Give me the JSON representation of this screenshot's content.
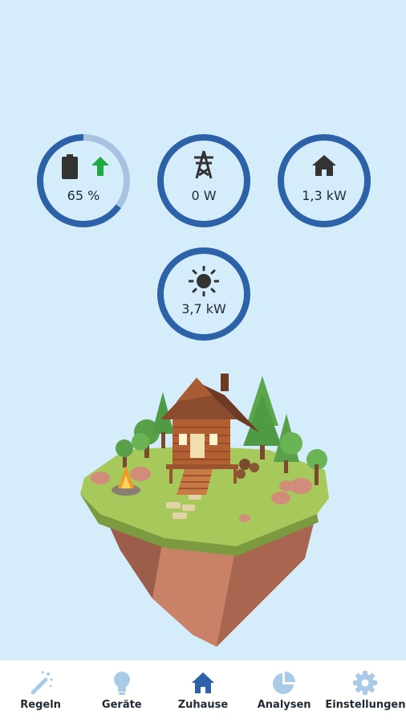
{
  "gauges": {
    "battery": {
      "value": "65 %",
      "level": 0.65,
      "icons": [
        "battery-icon",
        "arrow-up-icon"
      ]
    },
    "grid": {
      "value": "0 W",
      "level": 1.0,
      "icon": "power-pylon-icon"
    },
    "home": {
      "value": "1,3 kW",
      "level": 1.0,
      "icon": "house-icon"
    },
    "solar": {
      "value": "3,7 kW",
      "level": 1.0,
      "icon": "sun-icon"
    }
  },
  "colors": {
    "background": "#d5edfb",
    "ring": "#2d62a8",
    "ring_track": "#a8c3e2",
    "charging_arrow": "#1eaa3c",
    "nav_active": "#2d62a8",
    "nav_inactive": "#aacbe8"
  },
  "nav": {
    "items": [
      {
        "label": "Regeln",
        "icon": "magic-wand-icon"
      },
      {
        "label": "Geräte",
        "icon": "lightbulb-icon"
      },
      {
        "label": "Zuhause",
        "icon": "house-icon",
        "active": true
      },
      {
        "label": "Analysen",
        "icon": "pie-chart-icon"
      },
      {
        "label": "Einstellungen",
        "icon": "gear-icon"
      }
    ]
  }
}
